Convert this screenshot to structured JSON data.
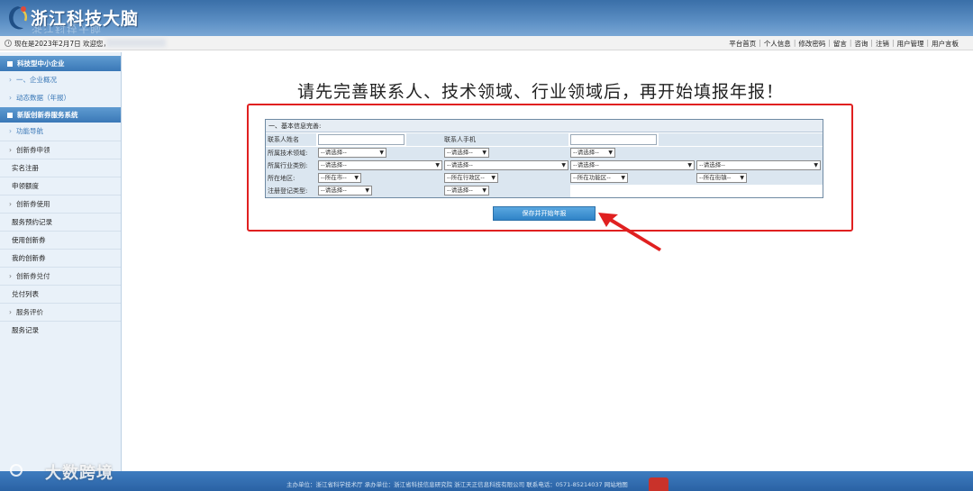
{
  "header": {
    "title": "浙江科技大脑",
    "title_reflection": "浙江科技大脑"
  },
  "infobar": {
    "welcome": "现在是2023年2月7日 欢迎您，",
    "nav": [
      "平台首页",
      "个人信息",
      "修改密码",
      "留言",
      "咨询",
      "注销",
      "用户管理",
      "用户言板"
    ]
  },
  "sidebar": {
    "section1": "科技型中小企业",
    "sub1": "一、企业概况",
    "sub2": "动态数据（年报）",
    "section2": "新版创新券服务系统",
    "sub3": "功能导航",
    "grp1": "创新券申领",
    "item_real": "实名注册",
    "item_quota": "申领额度",
    "grp2": "创新券使用",
    "item_booking": "服务预约记录",
    "item_use": "使用创新券",
    "item_mine": "我的创新券",
    "grp3": "创新券兑付",
    "item_paylist": "兑付列表",
    "grp4": "服务评价",
    "item_record": "服务记录"
  },
  "main": {
    "message": "请先完善联系人、技术领域、行业领域后，再开始填报年报！"
  },
  "form": {
    "title": "一、基本信息完善:",
    "contact_name_label": "联系人姓名",
    "contact_name_value": "",
    "contact_phone_label": "联系人手机",
    "contact_phone_value": "",
    "tech_label": "所属技术领域:",
    "industry_label": "所属行业类别:",
    "region_label": "所在地区:",
    "regtype_label": "注册登记类型:",
    "select_placeholder": "--请选择--",
    "city_placeholder": "--所在市--",
    "district_placeholder": "--所在行政区--",
    "zone_placeholder": "--所在功能区--",
    "street_placeholder": "--所在街镇--"
  },
  "save_button": "保存并开始年报",
  "footer": {
    "text": "主办单位：浙江省科学技术厅  承办单位：浙江省科技信息研究院 浙江天正信息科技有限公司 联系电话：0571-85214037 网站地图"
  },
  "watermark": "大数跨境",
  "colors": {
    "header": "#3a6fa8",
    "accent": "#3a78b7",
    "highlight": "#e02020",
    "button": "#2f83c7"
  }
}
